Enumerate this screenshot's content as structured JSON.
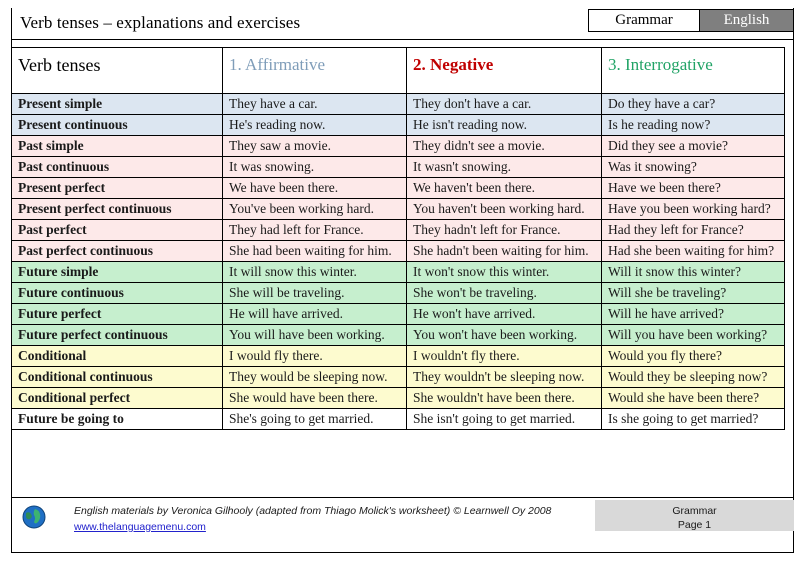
{
  "header": {
    "title": "Verb tenses – explanations and exercises",
    "subject_box": "Grammar",
    "language_box": "English",
    "language_box_bg": "#7f7f7f"
  },
  "table": {
    "columns": [
      {
        "label": "Verb tenses",
        "color": "#000000"
      },
      {
        "label": "1. Affirmative",
        "color": "#7f9db9"
      },
      {
        "label": "2. Negative",
        "color": "#c00000"
      },
      {
        "label": "3. Interrogative",
        "color": "#21a366"
      }
    ],
    "group_colors": {
      "present": "#dce6f1",
      "past": "#fde9e9",
      "future": "#c6efce",
      "conditional": "#fdfbcf",
      "plain": "#ffffff"
    },
    "rows": [
      {
        "group": "g-present",
        "tense": "Present simple",
        "affirmative": "They have a car.",
        "negative": "They don't have a car.",
        "interrogative": "Do they have a car?"
      },
      {
        "group": "g-present",
        "tense": "Present continuous",
        "affirmative": "He's reading now.",
        "negative": "He isn't reading now.",
        "interrogative": "Is he reading now?"
      },
      {
        "group": "g-past",
        "tense": "Past simple",
        "affirmative": "They saw a movie.",
        "negative": "They didn't see a movie.",
        "interrogative": "Did they see a movie?"
      },
      {
        "group": "g-past",
        "tense": "Past continuous",
        "affirmative": "It was snowing.",
        "negative": "It wasn't snowing.",
        "interrogative": "Was it snowing?"
      },
      {
        "group": "g-past",
        "tense": "Present perfect",
        "affirmative": "We have been there.",
        "negative": "We haven't been there.",
        "interrogative": "Have we been there?"
      },
      {
        "group": "g-past",
        "tense": "Present perfect continuous",
        "affirmative": "You've been working hard.",
        "negative": "You haven't been working hard.",
        "interrogative": "Have you been working hard?"
      },
      {
        "group": "g-past",
        "tense": "Past perfect",
        "affirmative": "They had left for France.",
        "negative": "They hadn't left for France.",
        "interrogative": "Had they left for France?"
      },
      {
        "group": "g-past",
        "tense": "Past perfect continuous",
        "affirmative": "She had been waiting for him.",
        "negative": "She hadn't been waiting for him.",
        "interrogative": "Had she been waiting for him?"
      },
      {
        "group": "g-future",
        "tense": "Future simple",
        "affirmative": "It will snow this winter.",
        "negative": "It won't snow this winter.",
        "interrogative": "Will it snow this winter?"
      },
      {
        "group": "g-future",
        "tense": "Future continuous",
        "affirmative": "She will be traveling.",
        "negative": "She won't be traveling.",
        "interrogative": "Will she be traveling?"
      },
      {
        "group": "g-future",
        "tense": "Future perfect",
        "affirmative": "He will have arrived.",
        "negative": "He won't have arrived.",
        "interrogative": "Will he have arrived?"
      },
      {
        "group": "g-future",
        "tense": "Future perfect continuous",
        "affirmative": "You will have been working.",
        "negative": "You won't have been working.",
        "interrogative": "Will you have been working?"
      },
      {
        "group": "g-cond",
        "tense": "Conditional",
        "affirmative": "I would fly there.",
        "negative": "I wouldn't fly there.",
        "interrogative": "Would you fly there?"
      },
      {
        "group": "g-cond",
        "tense": "Conditional continuous",
        "affirmative": "They would be sleeping now.",
        "negative": "They wouldn't be sleeping now.",
        "interrogative": "Would they be sleeping now?"
      },
      {
        "group": "g-cond",
        "tense": "Conditional perfect",
        "affirmative": "She would have been there.",
        "negative": "She wouldn't have been there.",
        "interrogative": "Would she have been there?"
      },
      {
        "group": "g-plain",
        "tense": "Future be going to",
        "affirmative": "She's going to get married.",
        "negative": "She isn't going to get married.",
        "interrogative": "Is she going to get married?"
      }
    ]
  },
  "footer": {
    "credit": "English materials by Veronica Gilhooly (adapted from Thiago Molick's worksheet) © Learnwell Oy 2008",
    "link": "www.thelanguagemenu.com",
    "subject": "Grammar",
    "page": "Page 1"
  }
}
